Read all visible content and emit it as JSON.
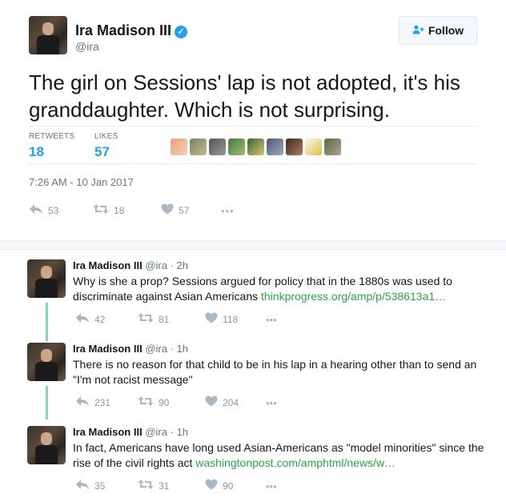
{
  "main_tweet": {
    "name": "Ira Madison III",
    "handle": "@ira",
    "follow_label": "Follow",
    "text": "The girl on Sessions' lap is not adopted, it's his granddaughter. Which is not surprising.",
    "retweets_label": "RETWEETS",
    "retweets_count": "18",
    "likes_label": "LIKES",
    "likes_count": "57",
    "timestamp": "7:26 AM - 10 Jan 2017",
    "actions": {
      "reply": "53",
      "retweet": "18",
      "like": "57"
    },
    "colors": {
      "accent": "#1da1f2",
      "muted": "#657786",
      "border": "#e6ecf0"
    }
  },
  "replies": [
    {
      "name": "Ira Madison III",
      "meta": "@ira · 2h",
      "text": "Why is she a prop? Sessions argued for policy that in the 1880s was used to discriminate against Asian Americans ",
      "link": "thinkprogress.org/amp/p/538613a1…",
      "actions": {
        "reply": "42",
        "retweet": "81",
        "like": "118"
      }
    },
    {
      "name": "Ira Madison III",
      "meta": "@ira · 1h",
      "text": "There is no reason for that child to be in his lap in a hearing other than to send an \"I'm not racist message\"",
      "link": "",
      "actions": {
        "reply": "231",
        "retweet": "90",
        "like": "204"
      }
    },
    {
      "name": "Ira Madison III",
      "meta": "@ira · 1h",
      "text": "In fact, Americans have long used Asian-Americans as \"model minorities\" since the rise of the civil rights act ",
      "link": "washingtonpost.com/amphtml/news/w…",
      "actions": {
        "reply": "35",
        "retweet": "31",
        "like": "90"
      }
    }
  ],
  "icons": {
    "verified": "verified-badge-icon",
    "follow": "add-person-icon",
    "reply": "reply-icon",
    "retweet": "retweet-icon",
    "like": "heart-icon",
    "more": "more-dots-icon"
  }
}
